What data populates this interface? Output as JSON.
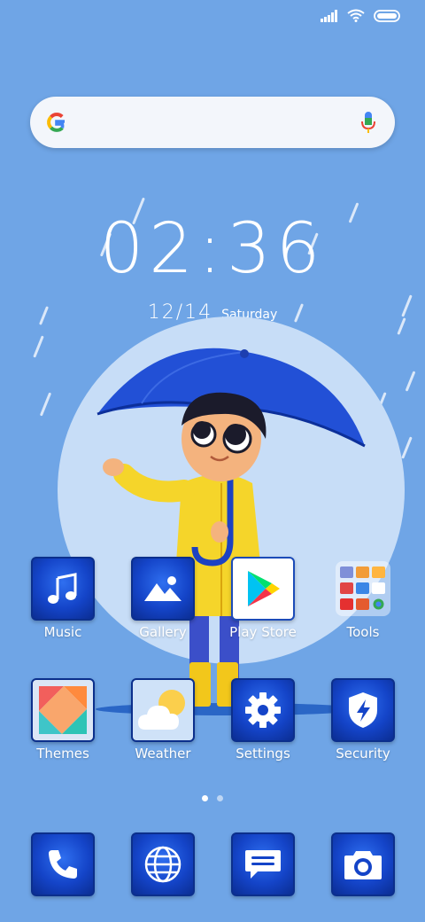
{
  "status_bar": {
    "icons": [
      "signal-icon",
      "wifi-icon",
      "battery-icon"
    ]
  },
  "search": {
    "icons": [
      "google-logo-icon",
      "microphone-icon"
    ]
  },
  "clock": {
    "time": "02:36",
    "date": "12/14",
    "weekday": "Saturday"
  },
  "apps": [
    {
      "label": "Music",
      "icon": "music-note-icon"
    },
    {
      "label": "Gallery",
      "icon": "gallery-mountain-icon"
    },
    {
      "label": "Play Store",
      "icon": "play-store-icon"
    },
    {
      "label": "Tools",
      "icon": "tools-folder-icon"
    },
    {
      "label": "Themes",
      "icon": "themes-icon"
    },
    {
      "label": "Weather",
      "icon": "weather-icon"
    },
    {
      "label": "Settings",
      "icon": "gear-icon"
    },
    {
      "label": "Security",
      "icon": "shield-bolt-icon"
    }
  ],
  "page_indicator": {
    "pages": 2,
    "active": 1
  },
  "dock": [
    {
      "icon": "phone-icon"
    },
    {
      "icon": "browser-globe-icon"
    },
    {
      "icon": "messages-icon"
    },
    {
      "icon": "camera-icon"
    }
  ],
  "colors": {
    "wallpaper": "#6fa5e6",
    "icon_blue": "#1444c8",
    "circle": "#c7ddf7"
  }
}
